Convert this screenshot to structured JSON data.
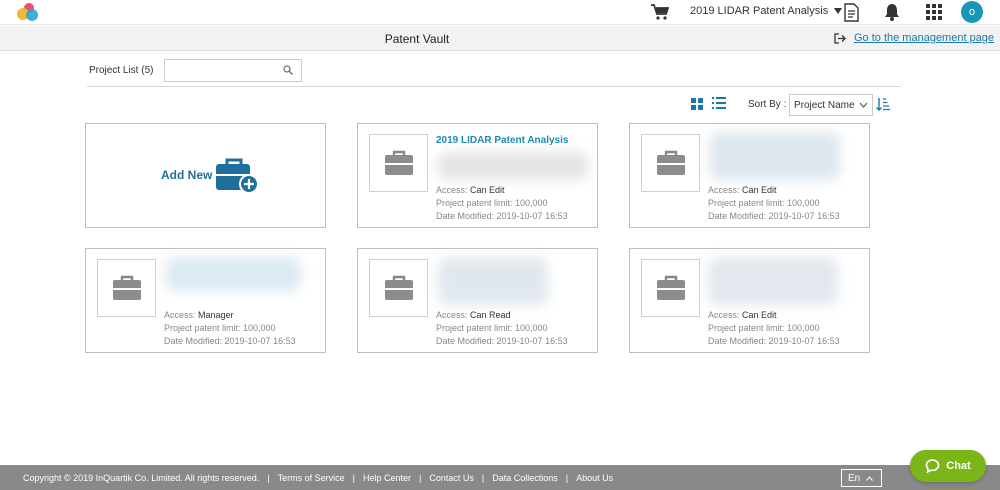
{
  "header": {
    "project_selector": "2019 LIDAR Patent Analysis",
    "avatar_initial": "o"
  },
  "titlebar": {
    "title": "Patent Vault",
    "management_link": "Go to the management page"
  },
  "toolbar": {
    "project_list_label": "Project List (5)",
    "search_placeholder": "",
    "sort_label": "Sort By :",
    "sort_value": "Project Name"
  },
  "add_new": {
    "label": "Add New"
  },
  "projects": [
    {
      "name": "2019 LIDAR Patent Analysis",
      "access_label": "Access:",
      "access": "Can Edit",
      "limit": "Project patent limit: 100,000",
      "modified": "Date Modified: 2019-10-07 16:53"
    },
    {
      "name": "",
      "access_label": "Access:",
      "access": "Can Edit",
      "limit": "Project patent limit: 100,000",
      "modified": "Date Modified: 2019-10-07 16:53"
    },
    {
      "name": "",
      "access_label": "Access:",
      "access": "Manager",
      "limit": "Project patent limit: 100,000",
      "modified": "Date Modified: 2019-10-07 16:53"
    },
    {
      "name": "",
      "access_label": "Access:",
      "access": "Can Read",
      "limit": "Project patent limit: 100,000",
      "modified": "Date Modified: 2019-10-07 16:53"
    },
    {
      "name": "",
      "access_label": "Access:",
      "access": "Can Edit",
      "limit": "Project patent limit: 100,000",
      "modified": "Date Modified: 2019-10-07 16:53"
    }
  ],
  "footer": {
    "copyright": "Copyright © 2019 InQuartik Co. Limited. All rights reserved.",
    "links": [
      "Terms of Service",
      "Help Center",
      "Contact Us",
      "Data Collections",
      "About Us"
    ],
    "language": "En"
  },
  "chat": {
    "label": "Chat"
  },
  "colors": {
    "accent": "#1a8bb0",
    "footer": "#898989",
    "chat": "#7cb518",
    "avatar": "#1797b7"
  },
  "icons": [
    "logo-icon",
    "cart-icon",
    "document-icon",
    "bell-icon",
    "apps-grid-icon",
    "exit-icon",
    "search-icon",
    "grid-view-icon",
    "list-view-icon",
    "sort-order-icon",
    "briefcase-icon",
    "briefcase-add-icon",
    "chat-bubble-icon",
    "chevron-up-icon"
  ]
}
